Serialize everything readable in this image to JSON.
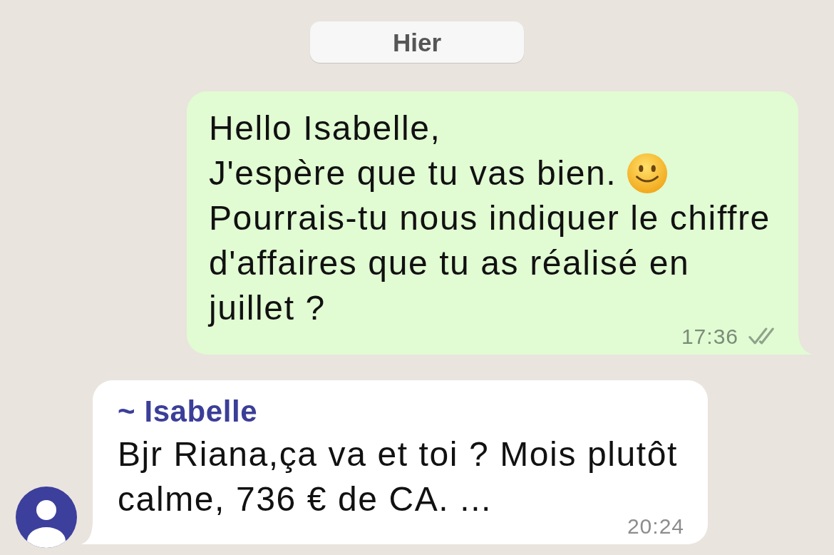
{
  "date_separator": {
    "text": "Hier"
  },
  "messages": [
    {
      "kind": "outgoing",
      "lines": [
        {
          "kind": "plain",
          "text": "Hello Isabelle,"
        },
        {
          "kind": "smiley",
          "text": "J'espère que tu vas bien."
        },
        {
          "kind": "plain",
          "text": "Pourrais-tu nous indiquer le chiffre d'affaires que tu as réalisé en juillet ?"
        }
      ],
      "time": "17:36",
      "read": false
    },
    {
      "kind": "incoming",
      "sender": "~ Isabelle",
      "lines": [
        {
          "kind": "plain",
          "text": "Bjr Riana,ça va et toi ? Mois plutôt calme, 736 € de CA. ..."
        }
      ],
      "time": "20:24"
    }
  ]
}
